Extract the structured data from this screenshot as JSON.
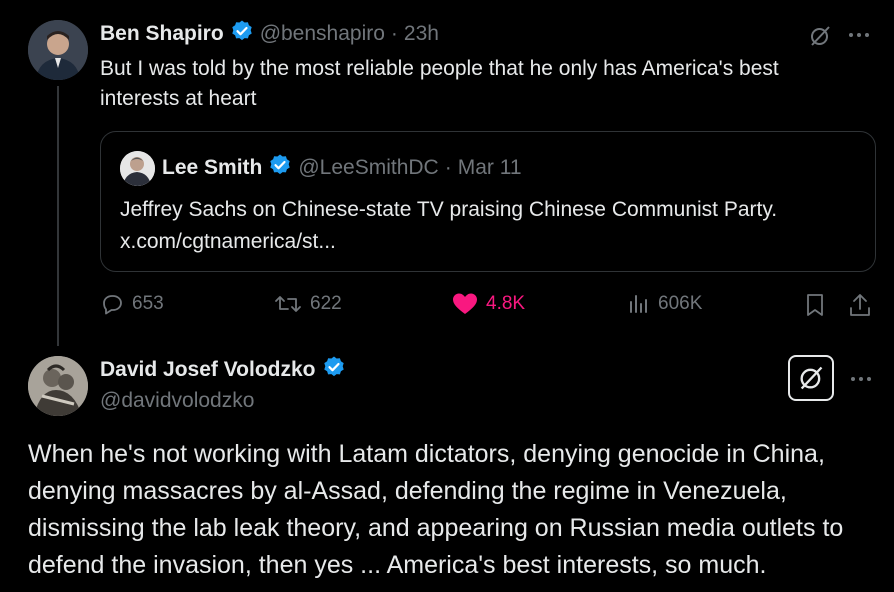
{
  "tweet1": {
    "author_name": "Ben Shapiro",
    "handle": "@benshapiro",
    "separator": "·",
    "time": "23h",
    "text": "But I was told by the most reliable people that he only has America's best interests at heart",
    "more_icon": "more-icon",
    "grok_icon": "grok-icon",
    "quote": {
      "author_name": "Lee Smith",
      "handle": "@LeeSmithDC",
      "separator": "·",
      "date": "Mar 11",
      "text": "Jeffrey Sachs on Chinese-state TV praising Chinese Communist Party.",
      "link": "x.com/cgtnamerica/st..."
    },
    "actions": {
      "replies": "653",
      "reposts": "622",
      "likes": "4.8K",
      "views": "606K"
    },
    "colors": {
      "like": "#f91880",
      "verified": "#1d9bf0"
    }
  },
  "tweet2": {
    "author_name": "David Josef Volodzko",
    "handle": "@davidvolodzko",
    "text": "When he's not working with Latam dictators, denying genocide in China, denying massacres by al-Assad, defending the regime in Venezuela, dismissing the lab leak theory, and appearing on Russian media outlets to defend the invasion, then yes ... America's best interests, so much."
  }
}
